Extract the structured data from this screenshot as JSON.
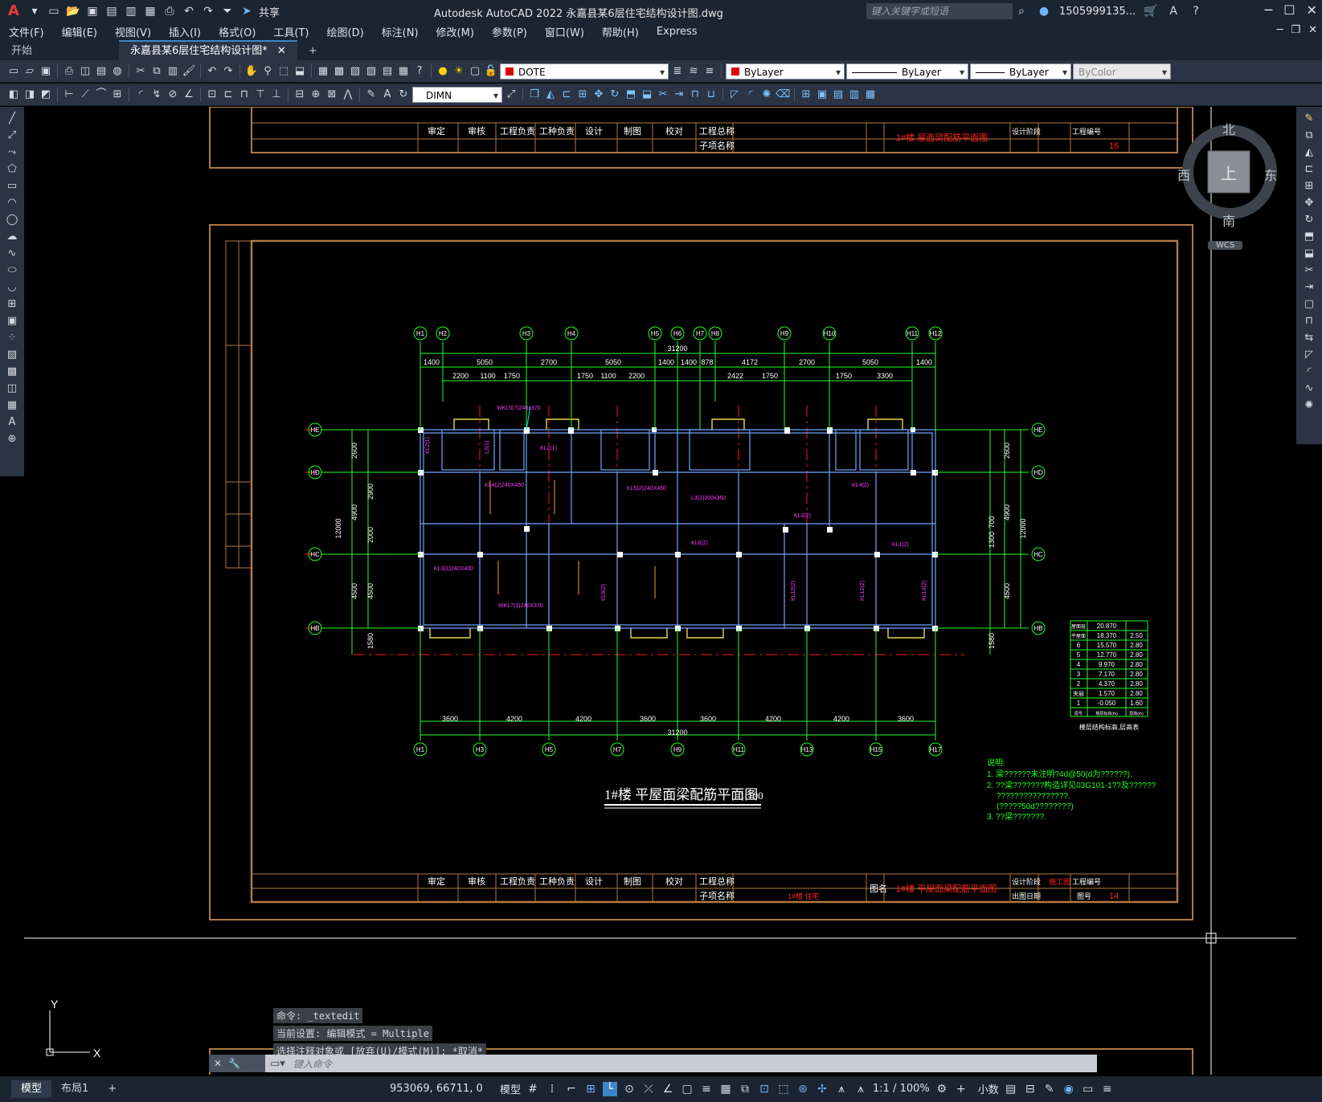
{
  "window": {
    "title": "Autodesk AutoCAD 2022     永嘉县某6层住宅结构设计图.dwg",
    "share_label": "共享",
    "search_placeholder": "键入关键字或短语",
    "user": "1505999135...",
    "app_logo": "A"
  },
  "menu": [
    "文件(F)",
    "编辑(E)",
    "视图(V)",
    "插入(I)",
    "格式(O)",
    "工具(T)",
    "绘图(D)",
    "标注(N)",
    "修改(M)",
    "参数(P)",
    "窗口(W)",
    "帮助(H)",
    "Express"
  ],
  "tabs": [
    {
      "label": "开始"
    },
    {
      "label": "永嘉县某6层住宅结构设计图*"
    }
  ],
  "toolbar": {
    "layer": "DOTE",
    "color": "ByLayer",
    "linetype": "ByLayer",
    "lineweight": "ByLayer",
    "plotstyle": "ByColor",
    "dimstyle": "DIMN"
  },
  "viewcube": {
    "north": "北",
    "south": "南",
    "east": "东",
    "west": "西",
    "top": "上",
    "wcs": "WCS"
  },
  "drawing": {
    "title": "1#楼 平屋面梁配筋平面图",
    "scale": "1:100",
    "top_axes": [
      "H1",
      "H2",
      "H3",
      "H4",
      "H5",
      "H6",
      "H7",
      "H8",
      "H9",
      "H10",
      "H11",
      "H12"
    ],
    "top_dims_total": "31200",
    "top_dims_row1": [
      "1400",
      "5050",
      "2700",
      "5050",
      "1400",
      "1400",
      "878",
      "4172",
      "2700",
      "5050",
      "1400"
    ],
    "top_dims_row2": [
      "2200",
      "1100",
      "1750",
      "1750",
      "1100",
      "2200",
      "2422",
      "1750",
      "1750",
      "3300"
    ],
    "bottom_axes": [
      "H1",
      "H3",
      "H5",
      "H7",
      "H9",
      "H11",
      "H13",
      "H15",
      "H17"
    ],
    "bottom_dims": [
      "3600",
      "4200",
      "4200",
      "3600",
      "3600",
      "4200",
      "4200",
      "3600"
    ],
    "bottom_total": "31200",
    "side_axes": [
      "HE",
      "HD",
      "HC",
      "HB"
    ],
    "left_dims": [
      "2600",
      "4900",
      "2900",
      "12000",
      "2000",
      "4500",
      "4500",
      "1580"
    ],
    "right_dims": [
      "2600",
      "4900",
      "12000",
      "1300",
      "700",
      "4500",
      "1580"
    ],
    "notes_title": "说明:",
    "notes": [
      "1. 梁??????未注明?4d@50(d为??????).",
      "2. ??梁???????构造详见03G101-1??及??????",
      "   ????????????????.",
      "   (?????50d????????)",
      "3. ??梁???????."
    ],
    "floor_table_title": "楼层结构标高,层高表",
    "floor_table": [
      [
        "屋面层",
        "20.870",
        ""
      ],
      [
        "平屋面",
        "18.370",
        "2.50"
      ],
      [
        "6",
        "15.570",
        "2.80"
      ],
      [
        "5",
        "12.770",
        "2.80"
      ],
      [
        "4",
        "9.970",
        "2.80"
      ],
      [
        "3",
        "7.170",
        "2.80"
      ],
      [
        "2",
        "4.370",
        "2.80"
      ],
      [
        "夹层",
        "1.570",
        "2.80"
      ],
      [
        "1",
        "-0.050",
        "1.60"
      ],
      [
        "层号",
        "楼层标高(m)",
        "层高(m)"
      ]
    ],
    "title_block": {
      "labels": [
        "审定",
        "审核",
        "工程负责",
        "工种负责",
        "设计",
        "制图",
        "校对",
        "工程总称",
        "子项名称",
        "图名",
        "设计阶段",
        "工程编号",
        "出图日期",
        "图号"
      ],
      "drawing_name_upper": "1#楼 屋面梁配筋平面图",
      "drawing_name_lower": "1#楼 平屋面梁配筋平面图",
      "stage": "施工图",
      "sheet_upper": "16",
      "sheet_lower": "14",
      "subproject": "1#楼 住宅"
    },
    "beam_labels": [
      "KL2(1)",
      "L2(1)",
      "KL2(1)",
      "WKL5(7)240x370",
      "KL4(2)240X450",
      "KL5(2)240X450",
      "L3(2)200x350",
      "KL3(2)",
      "KL4(2)",
      "KL3(1)240X400",
      "KL8(2)",
      "KL10(2)",
      "KL12(2)",
      "KL13(2)",
      "WKL7(1)240X370",
      "KL1(2)",
      "KL6(2)"
    ]
  },
  "command": {
    "lines": [
      "命令: _textedit",
      "当前设置: 编辑模式 = Multiple",
      "选择注释对象或 [放弃(U)/模式(M)]: *取消*"
    ],
    "placeholder": "键入命令"
  },
  "ucs": {
    "x": "X",
    "y": "Y"
  },
  "status": {
    "layout_tabs": [
      "模型",
      "布局1"
    ],
    "coords": "953069, 66711, 0",
    "model": "模型",
    "scale": "1:1 / 100%",
    "units": "小数"
  }
}
